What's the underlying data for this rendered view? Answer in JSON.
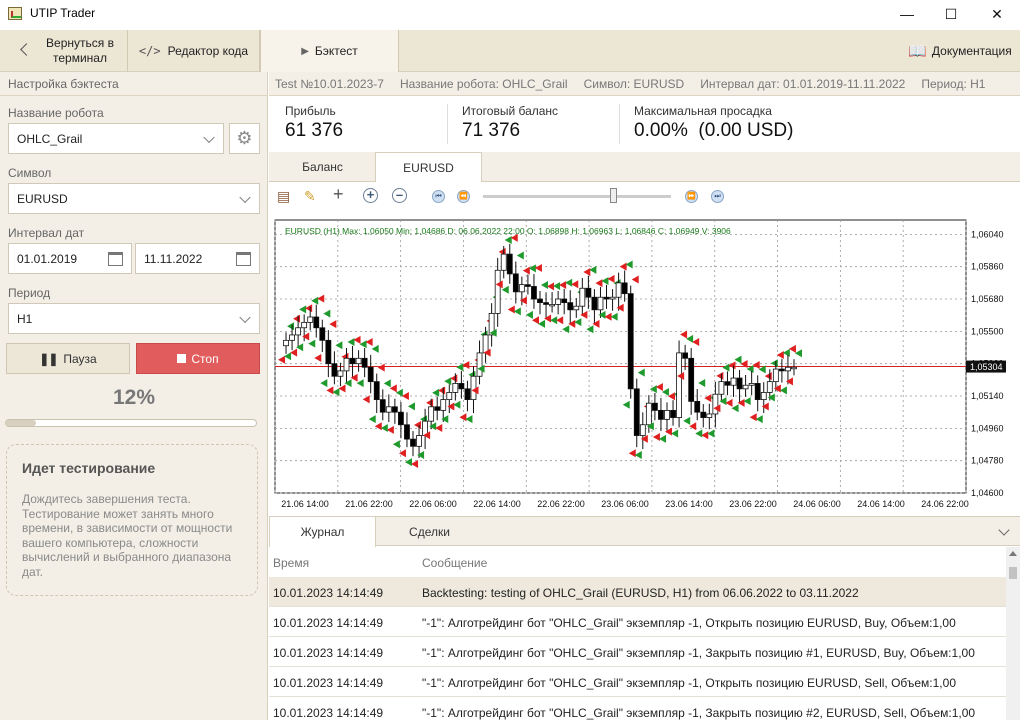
{
  "window": {
    "title": "UTIP Trader"
  },
  "toolbar": {
    "back_label": "Вернуться в терминал",
    "code_editor_label": "Редактор кода",
    "backtest_label": "Бэктест",
    "docs_label": "Документация"
  },
  "sidebar": {
    "header": "Настройка бэктеста",
    "robot_label": "Название робота",
    "robot_value": "OHLC_Grail",
    "symbol_label": "Символ",
    "symbol_value": "EURUSD",
    "dates_label": "Интервал дат",
    "date_from": "01.01.2019",
    "date_to": "11.11.2022",
    "period_label": "Период",
    "period_value": "H1",
    "pause_label": "Пауза",
    "stop_label": "Стоп",
    "progress_text": "12%",
    "progress_value": 0.12,
    "status_title": "Идет тестирование",
    "status_text": "Дождитесь завершения теста. Тестирование может занять много времени, в зависимости от мощности вашего компьютера, сложности вычислений и выбранного диапазона дат."
  },
  "testinfo": {
    "test": "Test №10.01.2023-7",
    "robot": "Название робота: OHLC_Grail",
    "symbol": "Символ: EURUSD",
    "interval": "Интервал дат: 01.01.2019-11.11.2022",
    "period": "Период: H1"
  },
  "stats": {
    "profit_label": "Прибыль",
    "profit_value": "61 376",
    "balance_label": "Итоговый баланс",
    "balance_value": "71 376",
    "drawdown_label": "Максимальная просадка",
    "drawdown_value": "0.00%  (0.00 USD)"
  },
  "chart_tabs": [
    "Баланс",
    "EURUSD"
  ],
  "chart_header": "EURUSD (H1)  Max: 1,06050  Min: 1,04686  D: 06.06.2022 22:00  O: 1,06898  H: 1,06963  L: 1,06846  C: 1,06949  V: 3906",
  "chart_data": {
    "type": "candlestick",
    "symbol": "EURUSD",
    "timeframe": "H1",
    "ylim": [
      1.046,
      1.0612
    ],
    "yticks": [
      "1,06040",
      "1,05860",
      "1,05680",
      "1,05500",
      "1,05320",
      "1,05140",
      "1,04960",
      "1,04780",
      "1,04600"
    ],
    "ytick_values": [
      1.0604,
      1.0586,
      1.0568,
      1.055,
      1.0532,
      1.0514,
      1.0496,
      1.0478,
      1.046
    ],
    "xticks": [
      "21.06 14:00",
      "21.06 22:00",
      "22.06 06:00",
      "22.06 14:00",
      "22.06 22:00",
      "23.06 06:00",
      "23.06 14:00",
      "23.06 22:00",
      "24.06 06:00",
      "24.06 14:00",
      "24.06 22:00"
    ],
    "current_price": "1,05304",
    "current_price_value": 1.05304,
    "grid": true,
    "bull_color": "#ffffff",
    "bear_color": "#000000",
    "buy_marker_color": "#1f9a2c",
    "sell_marker_color": "#e02020",
    "price_line_color": "#d62020",
    "closes": [
      1.0545,
      1.0548,
      1.0552,
      1.0555,
      1.0558,
      1.0552,
      1.0545,
      1.0532,
      1.0525,
      1.0528,
      1.0535,
      1.0532,
      1.0535,
      1.053,
      1.0522,
      1.0512,
      1.0505,
      1.0508,
      1.0505,
      1.0498,
      1.049,
      1.0486,
      1.0492,
      1.05,
      1.0508,
      1.0506,
      1.0512,
      1.0516,
      1.0521,
      1.0518,
      1.0512,
      1.0525,
      1.0538,
      1.0548,
      1.056,
      1.0584,
      1.0593,
      1.0582,
      1.0572,
      1.0576,
      1.0575,
      1.0568,
      1.0566,
      1.0565,
      1.0565,
      1.0568,
      1.0566,
      1.0562,
      1.0564,
      1.0574,
      1.0569,
      1.0562,
      1.0569,
      1.0568,
      1.0569,
      1.0577,
      1.0571,
      1.0518,
      1.0492,
      1.0498,
      1.051,
      1.0506,
      1.0501,
      1.0506,
      1.0502,
      1.0538,
      1.0535,
      1.0511,
      1.0505,
      1.0502,
      1.0504,
      1.0515,
      1.0522,
      1.052,
      1.0524,
      1.0518,
      1.052,
      1.0521,
      1.0512,
      1.0516,
      1.0522,
      1.0529,
      1.0528,
      1.053,
      1.053
    ]
  },
  "log": {
    "tabs": [
      "Журнал",
      "Сделки"
    ],
    "col_time": "Время",
    "col_message": "Сообщение",
    "rows": [
      {
        "time": "10.01.2023 14:14:49",
        "message": "Backtesting: testing of OHLC_Grail (EURUSD, H1) from 06.06.2022 to 03.11.2022"
      },
      {
        "time": "10.01.2023 14:14:49",
        "message": "\"-1\": Алготрейдинг бот \"OHLC_Grail\" экземпляр -1, Открыть позицию EURUSD, Buy, Объем:1,00"
      },
      {
        "time": "10.01.2023 14:14:49",
        "message": "\"-1\": Алготрейдинг бот \"OHLC_Grail\" экземпляр -1, Закрыть позицию #1, EURUSD, Buy, Объем:1,00"
      },
      {
        "time": "10.01.2023 14:14:49",
        "message": "\"-1\": Алготрейдинг бот \"OHLC_Grail\" экземпляр -1, Открыть позицию EURUSD, Sell, Объем:1,00"
      },
      {
        "time": "10.01.2023 14:14:49",
        "message": "\"-1\": Алготрейдинг бот \"OHLC_Grail\" экземпляр -1, Закрыть позицию #2, EURUSD, Sell, Объем:1,00"
      }
    ]
  }
}
